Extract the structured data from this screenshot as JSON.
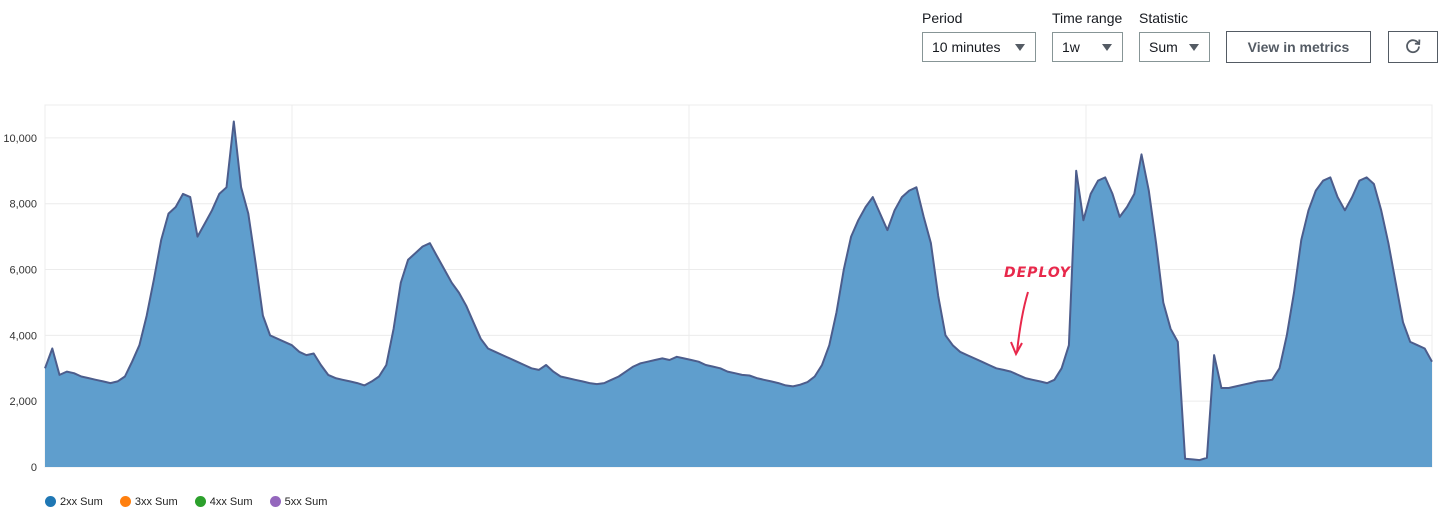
{
  "controls": {
    "period": {
      "label": "Period",
      "value": "10 minutes"
    },
    "time_range": {
      "label": "Time range",
      "value": "1w"
    },
    "statistic": {
      "label": "Statistic",
      "value": "Sum"
    },
    "view_metrics_label": "View in metrics",
    "refresh_icon": "refresh-icon"
  },
  "annotation": {
    "text": "DEPLOY",
    "color": "#e8284b"
  },
  "colors": {
    "area_fill": "#5f9ecd",
    "area_line": "#4c5d8c",
    "grid": "#ececec"
  },
  "chart_data": {
    "type": "area",
    "ylim": [
      0,
      11000
    ],
    "yticks": [
      0,
      2000,
      4000,
      6000,
      8000,
      10000
    ],
    "ytick_labels": [
      "0",
      "2,000",
      "4,000",
      "6,000",
      "8,000",
      "10,000"
    ],
    "x_samples": 194,
    "grid": true,
    "legend_position": "bottom-left",
    "series": [
      {
        "name": "2xx Sum",
        "color": "#1f77b4",
        "values": [
          3000,
          3600,
          2800,
          2900,
          2850,
          2750,
          2700,
          2650,
          2600,
          2550,
          2600,
          2750,
          3200,
          3700,
          4600,
          5700,
          6900,
          7700,
          7900,
          8300,
          8200,
          7000,
          7400,
          7800,
          8300,
          8500,
          10500,
          8500,
          7700,
          6200,
          4600,
          4000,
          3900,
          3800,
          3700,
          3500,
          3400,
          3450,
          3100,
          2800,
          2700,
          2650,
          2600,
          2550,
          2480,
          2600,
          2750,
          3100,
          4200,
          5600,
          6300,
          6500,
          6700,
          6800,
          6400,
          6000,
          5600,
          5300,
          4900,
          4400,
          3900,
          3600,
          3500,
          3400,
          3300,
          3200,
          3100,
          3000,
          2950,
          3100,
          2900,
          2750,
          2700,
          2650,
          2600,
          2550,
          2520,
          2550,
          2650,
          2750,
          2900,
          3050,
          3150,
          3200,
          3250,
          3300,
          3250,
          3350,
          3300,
          3250,
          3200,
          3100,
          3050,
          3000,
          2900,
          2850,
          2800,
          2780,
          2700,
          2650,
          2600,
          2550,
          2480,
          2450,
          2500,
          2580,
          2750,
          3100,
          3700,
          4700,
          6000,
          7000,
          7500,
          7900,
          8200,
          7700,
          7200,
          7800,
          8200,
          8400,
          8500,
          7600,
          6800,
          5200,
          4000,
          3700,
          3500,
          3400,
          3300,
          3200,
          3100,
          3000,
          2950,
          2900,
          2800,
          2700,
          2650,
          2600,
          2550,
          2650,
          3000,
          3700,
          9000,
          7500,
          8300,
          8700,
          8800,
          8300,
          7600,
          7900,
          8300,
          9500,
          8400,
          6800,
          5000,
          4200,
          3800,
          250,
          230,
          210,
          280,
          3400,
          2400,
          2400,
          2450,
          2500,
          2550,
          2600,
          2620,
          2650,
          3000,
          4000,
          5300,
          6900,
          7800,
          8400,
          8700,
          8800,
          8200,
          7800,
          8200,
          8700,
          8800,
          8600,
          7800,
          6800,
          5600,
          4400,
          3800,
          3700,
          3600,
          3200
        ]
      },
      {
        "name": "3xx Sum",
        "color": "#ff7f0e",
        "values": []
      },
      {
        "name": "4xx Sum",
        "color": "#2ca02c",
        "values": []
      },
      {
        "name": "5xx Sum",
        "color": "#9467bd",
        "values": []
      }
    ]
  }
}
